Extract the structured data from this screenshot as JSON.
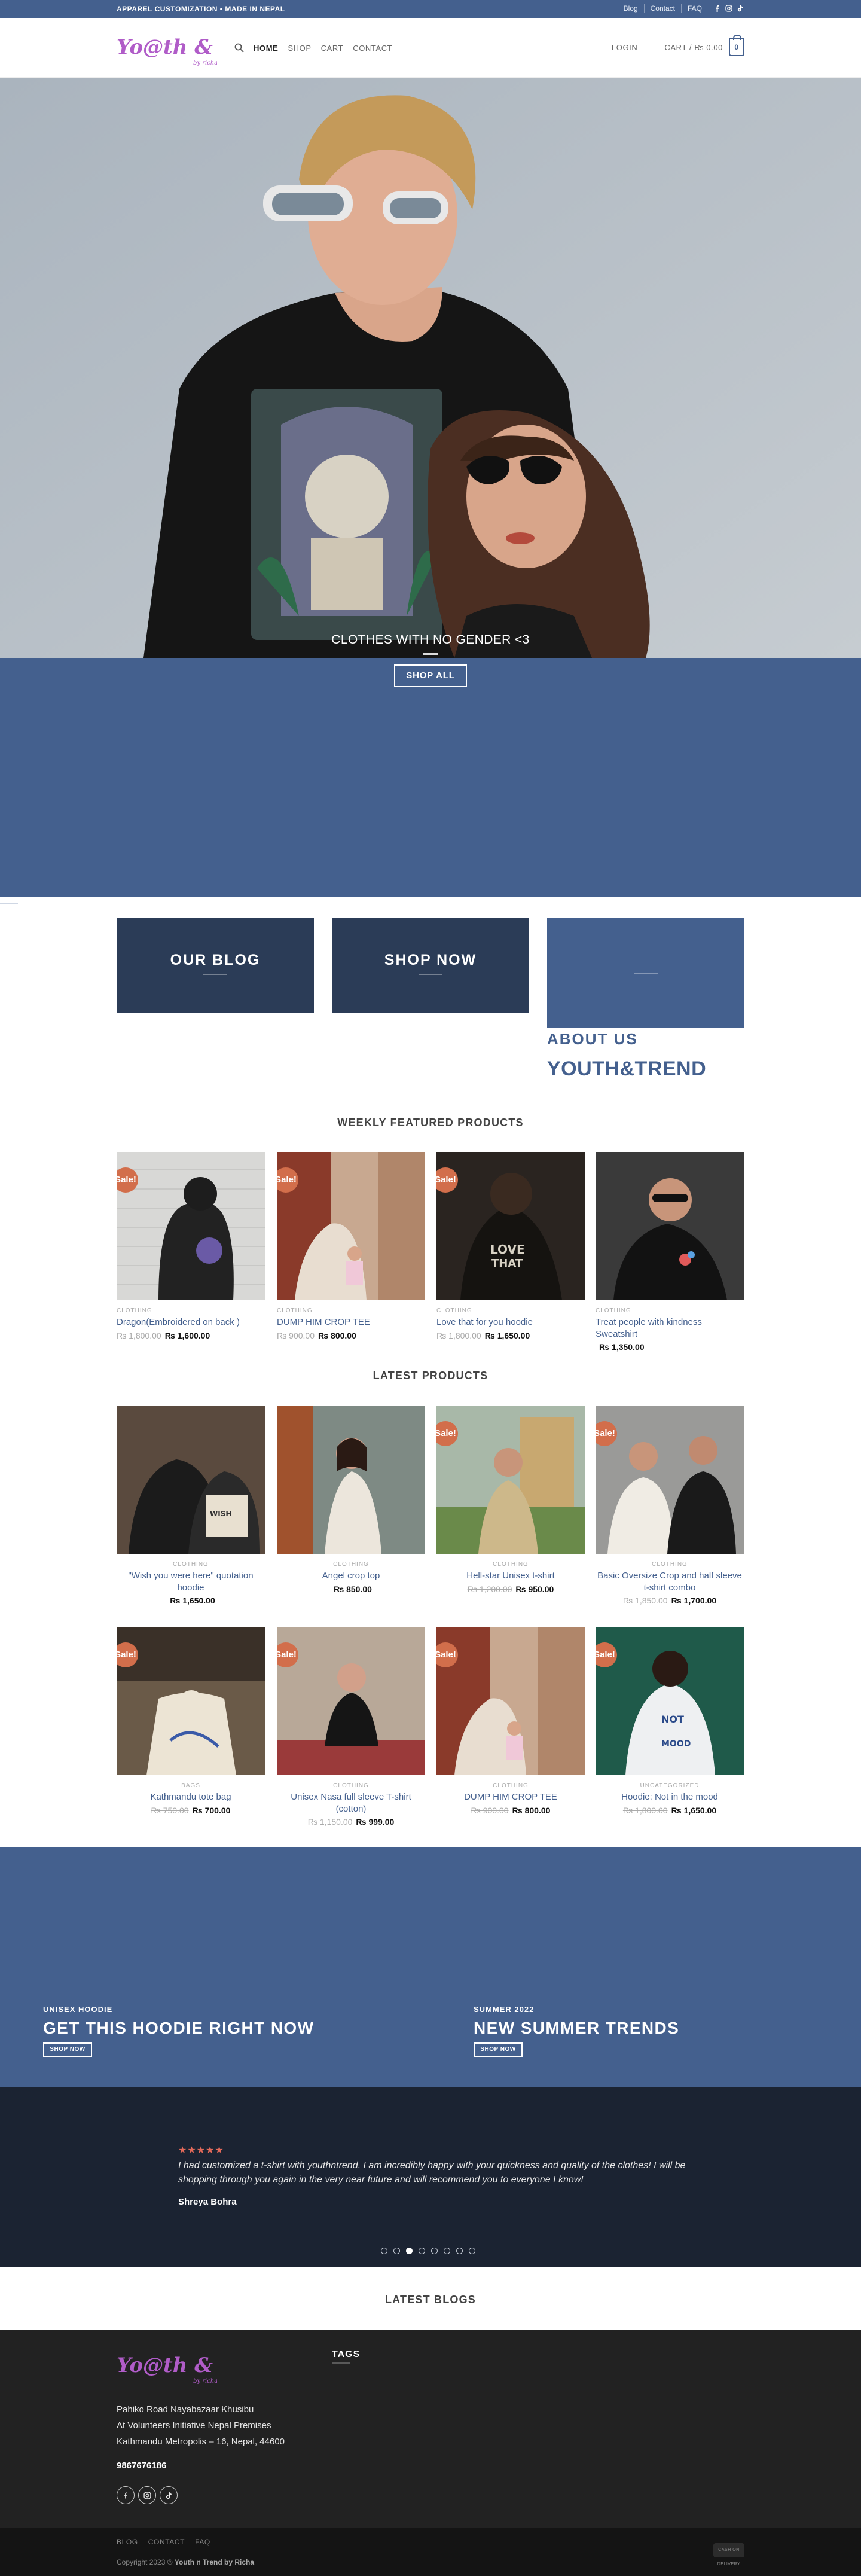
{
  "topbar": {
    "tagline": "APPAREL CUSTOMIZATION • MADE IN NEPAL",
    "links": [
      "Blog",
      "Contact",
      "FAQ"
    ],
    "social": [
      "facebook-icon",
      "instagram-icon",
      "tiktok-icon"
    ]
  },
  "header": {
    "logo_text": "Yo@th & Trend",
    "nav": [
      "HOME",
      "SHOP",
      "CART",
      "CONTACT"
    ],
    "login": "LOGIN",
    "cart_label": "CART /",
    "cart_total": "₨ 0.00",
    "cart_count": "0"
  },
  "hero": {
    "caption": "CLOTHES WITH NO GENDER <3",
    "button": "SHOP ALL"
  },
  "promos": {
    "blog": "OUR BLOG",
    "shop": "SHOP NOW",
    "about_sub": "ABOUT US",
    "about_title": "YOUTH&TREND"
  },
  "weekly": {
    "title": "WEEKLY FEATURED PRODUCTS",
    "products": [
      {
        "cat": "CLOTHING",
        "name": "Dragon(Embroidered on back )",
        "old": "₨ 1,800.00",
        "price": "₨ 1,600.00",
        "sale": "Sale!"
      },
      {
        "cat": "CLOTHING",
        "name": "DUMP HIM CROP TEE",
        "old": "₨ 900.00",
        "price": "₨ 800.00",
        "sale": "Sale!"
      },
      {
        "cat": "CLOTHING",
        "name": "Love that for you hoodie",
        "old": "₨ 1,800.00",
        "price": "₨ 1,650.00",
        "sale": "Sale!"
      },
      {
        "cat": "CLOTHING",
        "name": "Treat people with kindness Sweatshirt",
        "old": "",
        "price": "₨ 1,350.00",
        "sale": ""
      }
    ]
  },
  "latest": {
    "title": "LATEST PRODUCTS",
    "products": [
      {
        "cat": "CLOTHING",
        "name": "\"Wish you were here\" quotation hoodie",
        "old": "",
        "price": "₨ 1,650.00",
        "sale": ""
      },
      {
        "cat": "CLOTHING",
        "name": "Angel crop top",
        "old": "",
        "price": "₨ 850.00",
        "sale": ""
      },
      {
        "cat": "CLOTHING",
        "name": "Hell-star Unisex t-shirt",
        "old": "₨ 1,200.00",
        "price": "₨ 950.00",
        "sale": "Sale!"
      },
      {
        "cat": "CLOTHING",
        "name": "Basic Oversize Crop and half sleeve t-shirt combo",
        "old": "₨ 1,850.00",
        "price": "₨ 1,700.00",
        "sale": "Sale!"
      },
      {
        "cat": "BAGS",
        "name": "Kathmandu tote bag",
        "old": "₨ 750.00",
        "price": "₨ 700.00",
        "sale": "Sale!"
      },
      {
        "cat": "CLOTHING",
        "name": "Unisex Nasa full sleeve T-shirt (cotton)",
        "old": "₨ 1,150.00",
        "price": "₨ 999.00",
        "sale": "Sale!"
      },
      {
        "cat": "CLOTHING",
        "name": "DUMP HIM CROP TEE",
        "old": "₨ 900.00",
        "price": "₨ 800.00",
        "sale": "Sale!"
      },
      {
        "cat": "UNCATEGORIZED",
        "name": "Hoodie: Not in the mood",
        "old": "₨ 1,800.00",
        "price": "₨ 1,650.00",
        "sale": "Sale!"
      }
    ]
  },
  "banners": {
    "left_kicker": "UNISEX HOODIE",
    "left_title": "GET THIS HOODIE RIGHT NOW",
    "left_btn": "SHOP NOW",
    "right_kicker": "SUMMER 2022",
    "right_title": "NEW SUMMER TRENDS",
    "right_btn": "SHOP NOW"
  },
  "testimonial": {
    "stars": "★★★★★",
    "quote": "I had customized a t-shirt with youthntrend.  I am incredibly happy with your quickness and quality of the clothes! I will be shopping through you again in the very near future and will recommend you to everyone I know!",
    "author": "Shreya Bohra",
    "dot_count": 8,
    "active_dot": 3
  },
  "blogs": {
    "title": "LATEST BLOGS"
  },
  "footer": {
    "address_lines": [
      "Pahiko Road Nayabazaar Khusibu",
      "At Volunteers Initiative Nepal Premises",
      "Kathmandu Metropolis – 16, Nepal, 44600"
    ],
    "phone": "9867676186",
    "tags_title": "TAGS",
    "links": [
      "BLOG",
      "CONTACT",
      "FAQ"
    ],
    "copyright": "Copyright 2023 ©",
    "copyright_owner": "Youth n Trend by Richa",
    "badge": "CASH ON DELIVERY"
  },
  "colors": {
    "brand_blue": "#44608e",
    "navy": "#2b3c57",
    "sale": "#d26e4b",
    "dark": "#1b2332",
    "logo_purple": "#b05cc8"
  }
}
